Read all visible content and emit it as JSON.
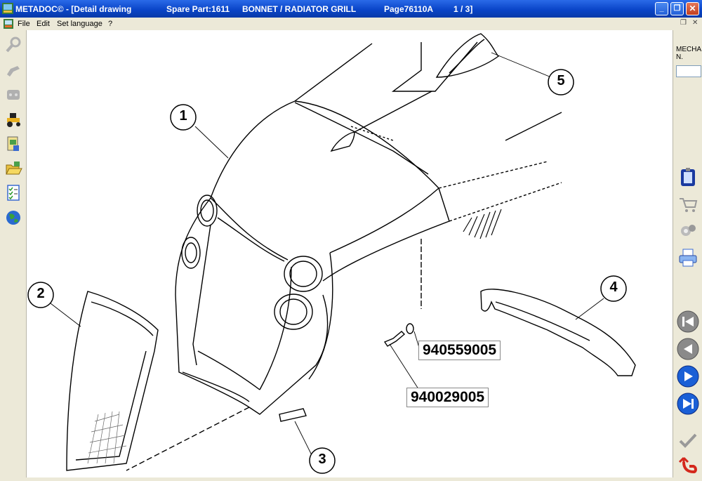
{
  "titlebar": {
    "app_title": "METADOC© - [Detail drawing",
    "spare_part": "Spare Part:1611",
    "section": "BONNET  / RADIATOR GRILL",
    "page": "Page76110A",
    "page_count": "1 / 3]",
    "minimize": "_",
    "restore": "❐",
    "close": "✕"
  },
  "menubar": {
    "items": [
      "File",
      "Edit",
      "Set language",
      "?"
    ],
    "mdi_restore": "❐",
    "mdi_close": "✕"
  },
  "left_toolbar": {
    "icons": [
      "search-icon",
      "tool-icon",
      "engine-icon",
      "tractor-icon",
      "catalog-icon",
      "folder-open-icon",
      "checklist-icon",
      "globe-icon"
    ]
  },
  "right_panel": {
    "mech_label": "MECHA\nN.",
    "mech_value": "",
    "icons": [
      "clipboard-icon",
      "cart-icon",
      "parts-icon",
      "printer-icon"
    ],
    "nav": [
      "first-page-icon",
      "previous-page-icon",
      "next-page-icon",
      "last-page-icon"
    ],
    "bottom_icons": [
      "check-icon",
      "back-icon"
    ]
  },
  "drawing": {
    "references": [
      "1",
      "2",
      "3",
      "4",
      "5"
    ],
    "part_numbers": [
      "940559005",
      "940029005"
    ]
  },
  "colors": {
    "titlebar": "#0a45c8",
    "nav_blue": "#1a5fd6",
    "nav_gray": "#8a8a8a",
    "back_red": "#d4281c"
  }
}
